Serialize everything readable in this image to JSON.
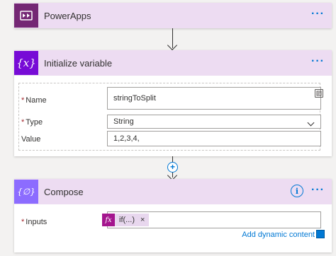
{
  "steps": {
    "powerapps": {
      "title": "PowerApps",
      "icon": "powerapps-icon",
      "color": "#742774",
      "more_label": "···"
    },
    "init_variable": {
      "title": "Initialize variable",
      "icon": "variable-icon",
      "icon_text": "{x}",
      "color": "#770bd6",
      "more_label": "···",
      "fields": {
        "name": {
          "label": "Name",
          "required": "*",
          "value": "stringToSplit"
        },
        "type": {
          "label": "Type",
          "required": "*",
          "value": "String"
        },
        "value": {
          "label": "Value",
          "value": "1,2,3,4,"
        }
      }
    },
    "compose": {
      "title": "Compose",
      "icon": "compose-icon",
      "icon_text": "{∅}",
      "color": "#8c6cff",
      "info_label": "i",
      "more_label": "···",
      "inputs": {
        "label": "Inputs",
        "required": "*",
        "token_icon": "fx",
        "token_text": "if(...)",
        "token_remove": "×"
      },
      "dynamic_content_link": "Add dynamic content"
    }
  },
  "connector": {
    "add_label": "+"
  },
  "accent_color": "#0078d4"
}
